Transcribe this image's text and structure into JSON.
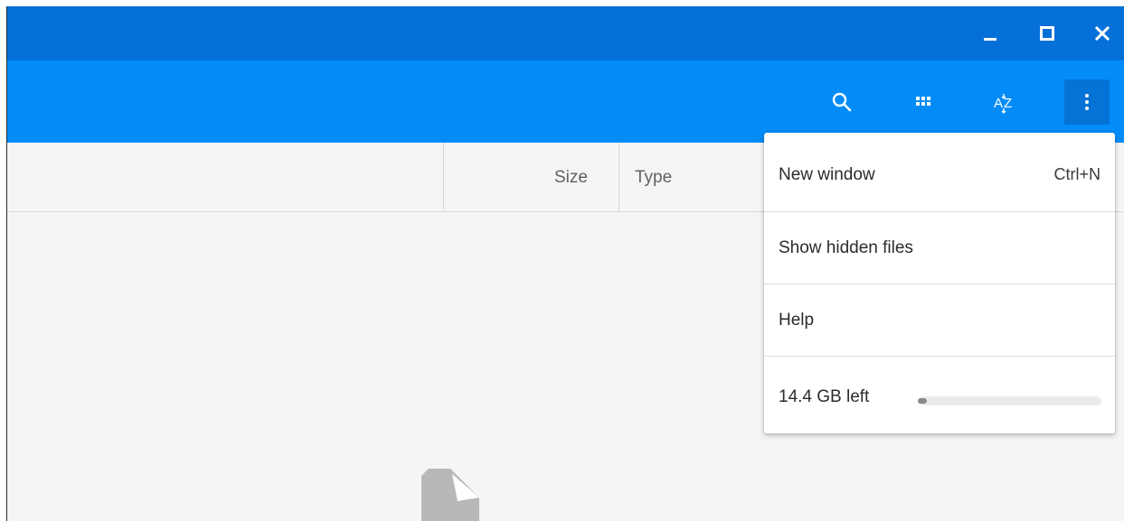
{
  "titlebar": {
    "minimize_icon": "minimize-icon",
    "maximize_icon": "maximize-icon",
    "close_icon": "close-icon"
  },
  "toolbar": {
    "search_icon": "search-icon",
    "grid_view_icon": "grid-view-icon",
    "sort_icon": "sort-az-icon",
    "more_icon": "more-vert-icon"
  },
  "columns": {
    "size": "Size",
    "type": "Type"
  },
  "menu": {
    "items": [
      {
        "label": "New window",
        "shortcut": "Ctrl+N"
      },
      {
        "label": "Show hidden files"
      },
      {
        "label": "Help"
      }
    ],
    "storage": {
      "label": "14.4 GB left",
      "used_fraction": 0.05
    }
  },
  "colors": {
    "titlebar": "#0670d9",
    "toolbar": "#038cf7",
    "active_button": "#0572d6",
    "content_bg": "#f5f5f5"
  }
}
